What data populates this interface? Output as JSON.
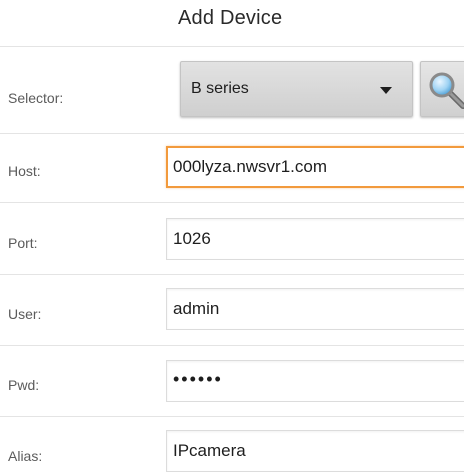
{
  "title": "Add Device",
  "selector": {
    "label": "Selector:",
    "value": "B series"
  },
  "host": {
    "label": "Host:",
    "value": "000lyza.nwsvr1.com"
  },
  "port": {
    "label": "Port:",
    "value": "1026"
  },
  "user": {
    "label": "User:",
    "value": "admin"
  },
  "pwd": {
    "label": "Pwd:",
    "value": "••••••"
  },
  "alias": {
    "label": "Alias:",
    "value": "IPcamera"
  },
  "colors": {
    "focus_border": "#f29a3c",
    "divider": "#e4e4e4"
  },
  "icons": {
    "search": "search-icon",
    "dropdown": "chevron-down-icon"
  }
}
